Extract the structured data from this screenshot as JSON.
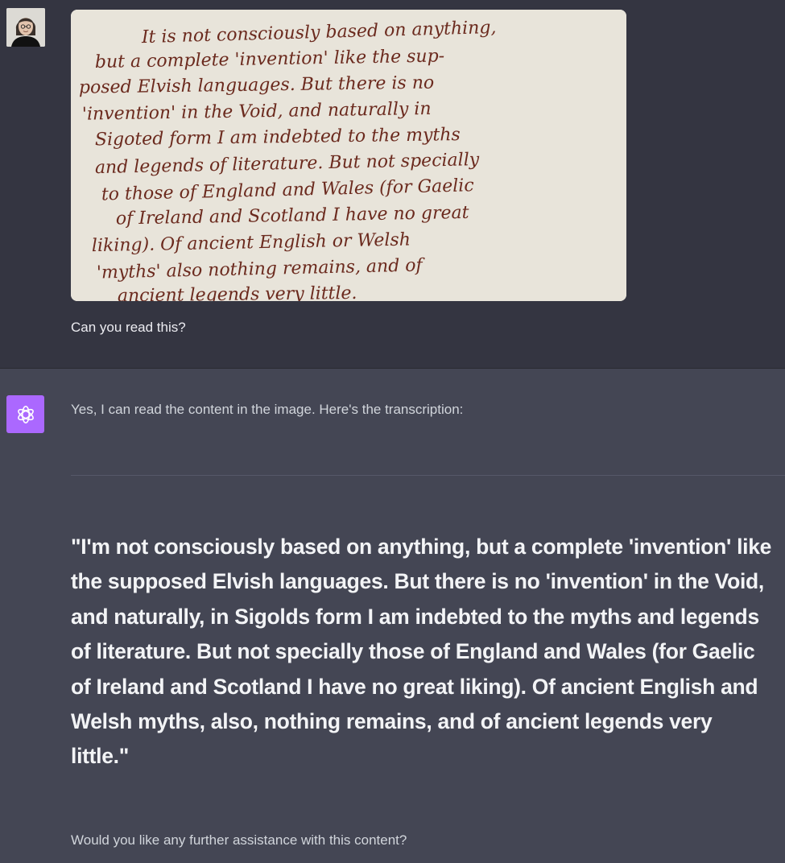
{
  "user": {
    "avatar_icon": "user-avatar-photo",
    "message": "Can you read this?",
    "image": {
      "alt": "",
      "handwritten_lines": [
        "It is not consciously based on anything,",
        "but a complete 'invention' like the sup-",
        "posed Elvish languages. But there is no",
        "'invention' in the Void, and naturally in",
        "Sigoted form I am indebted to the myths",
        "and legends of literature. But not specially",
        "to those of England and Wales (for Gaelic",
        "of Ireland and Scotland I have no great",
        "liking). Of ancient English or Welsh",
        "'myths' also nothing remains, and of",
        "ancient legends very little."
      ]
    }
  },
  "assistant": {
    "avatar_icon": "openai-logo-icon",
    "intro": "Yes, I can read the content in the image. Here's the transcription:",
    "transcription": "\"I'm not consciously based on anything, but a complete 'invention' like the supposed Elvish languages. But there is no 'invention' in the Void, and naturally, in Sigolds form I am indebted to the myths and legends of literature. But not specially those of England and Wales (for Gaelic of Ireland and Scotland I have no great liking). Of ancient English and Welsh myths, also, nothing remains, and of ancient legends very little.\"",
    "followup": "Would you like any further assistance with this content?"
  },
  "colors": {
    "user_bg": "#343541",
    "assistant_bg": "#444654",
    "assistant_avatar": "#ab68ff",
    "paper": "#e8e4da",
    "ink": "#6b2a1e"
  }
}
